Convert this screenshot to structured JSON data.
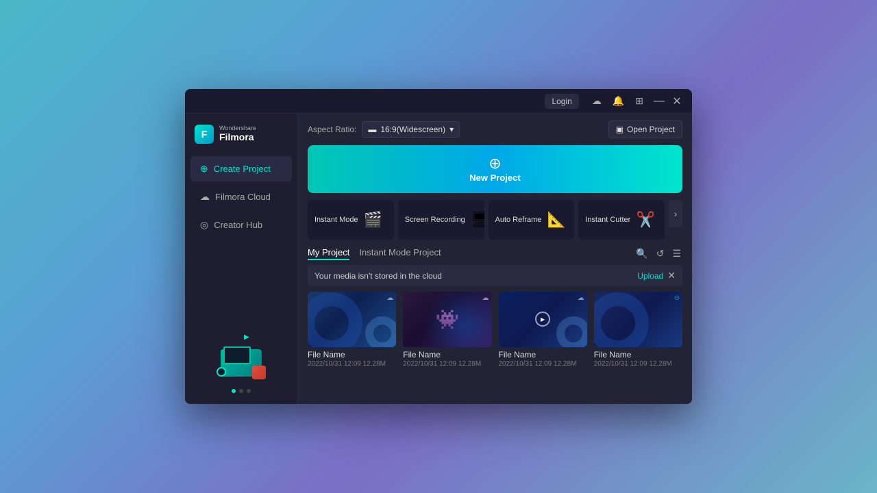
{
  "window": {
    "title": "Wondershare Filmora"
  },
  "titlebar": {
    "login_label": "Login",
    "cloud_icon": "☁",
    "sound_icon": "🔔",
    "grid_icon": "⊞",
    "min_icon": "—",
    "close_icon": "✕"
  },
  "brand": {
    "name_top": "Wondershare",
    "name": "Filmora"
  },
  "nav": {
    "items": [
      {
        "id": "create-project",
        "label": "Create Project",
        "icon": "⊕",
        "active": true
      },
      {
        "id": "filmora-cloud",
        "label": "Filmora Cloud",
        "icon": "☁"
      },
      {
        "id": "creator-hub",
        "label": "Creator Hub",
        "icon": "◎"
      }
    ]
  },
  "dots": [
    {
      "active": true
    },
    {
      "active": false
    },
    {
      "active": false
    }
  ],
  "toolbar": {
    "aspect_label": "Aspect Ratio:",
    "aspect_icon": "▬",
    "aspect_value": "16:9(Widescreen)",
    "open_project_icon": "▣",
    "open_project_label": "Open Project"
  },
  "new_project": {
    "plus": "⊕",
    "label": "New Project"
  },
  "mode_cards": [
    {
      "id": "instant-mode",
      "label": "Instant Mode",
      "icon": "🎬"
    },
    {
      "id": "screen-recording",
      "label": "Screen Recording",
      "icon": "🖥"
    },
    {
      "id": "auto-reframe",
      "label": "Auto Reframe",
      "icon": "📐"
    },
    {
      "id": "instant-cutter",
      "label": "Instant Cutter",
      "icon": "✂"
    }
  ],
  "arrow": "›",
  "projects": {
    "tabs": [
      {
        "id": "my-project",
        "label": "My Project",
        "active": true
      },
      {
        "id": "instant-mode-project",
        "label": "Instant Mode Project",
        "active": false
      }
    ],
    "search_icon": "🔍",
    "refresh_icon": "↺",
    "layout_icon": "☰"
  },
  "cloud_banner": {
    "text": "Your media isn't stored in the cloud",
    "upload_label": "Upload",
    "close_icon": "✕"
  },
  "files": [
    {
      "id": "file-1",
      "name": "File Name",
      "date": "2022/10/31",
      "time": "12:09",
      "size": "12.28M",
      "thumb": "blue-arc"
    },
    {
      "id": "file-2",
      "name": "File Name",
      "date": "2022/10/31",
      "time": "12:09",
      "size": "12.28M",
      "thumb": "dark-figure"
    },
    {
      "id": "file-3",
      "name": "File Name",
      "date": "2022/10/31",
      "time": "12:09",
      "size": "12.28M",
      "thumb": "blue-play"
    },
    {
      "id": "file-4",
      "name": "File Name",
      "date": "2022/10/31",
      "time": "12:09",
      "size": "12.28M",
      "thumb": "blue-arc2"
    }
  ]
}
